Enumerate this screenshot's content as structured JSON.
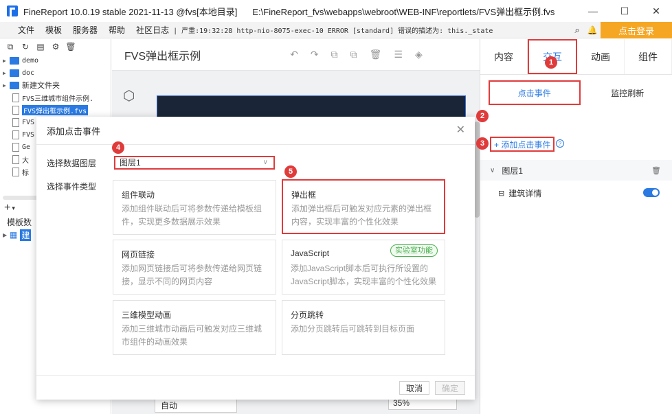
{
  "titlebar": {
    "app_title": "FineReport 10.0.19 stable 2021-11-13 @fvs[本地目录]",
    "path": "E:\\FineReport_fvs\\webapps\\webroot\\WEB-INF\\reportlets/FVS弹出框示例.fvs",
    "minimize": "—",
    "maximize": "☐",
    "close": "✕"
  },
  "menubar": {
    "items": [
      "文件",
      "模板",
      "服务器",
      "帮助",
      "社区日志"
    ],
    "log": "| 严重:19:32:28 http-nio-8075-exec-10 ERROR [standard] 错误的描述为: this._state",
    "login": "点击登录"
  },
  "left": {
    "tree": [
      {
        "label": "demo",
        "type": "folder"
      },
      {
        "label": "doc",
        "type": "folder"
      },
      {
        "label": "新建文件夹",
        "type": "folder"
      },
      {
        "label": "FVS三维城市组件示例.",
        "type": "file"
      },
      {
        "label": "FVS弹出框示例.fvs",
        "type": "file",
        "selected": true
      },
      {
        "label": "FVS",
        "type": "file"
      },
      {
        "label": "FVS",
        "type": "file"
      },
      {
        "label": "Ge",
        "type": "file"
      },
      {
        "label": "大",
        "type": "file"
      },
      {
        "label": "标",
        "type": "file"
      }
    ],
    "lower_label": "模板数",
    "lower_item": "建"
  },
  "center": {
    "doc_title": "FVS弹出框示例",
    "zoom_mode": "自动",
    "zoom_pct": "35%"
  },
  "right": {
    "tabs": [
      "内容",
      "交互",
      "动画",
      "组件"
    ],
    "active_tab": "交互",
    "subtabs": [
      "点击事件",
      "监控刷新"
    ],
    "add_event": "+ 添加点击事件",
    "help": "?",
    "layer": "图层1",
    "event": "建筑详情"
  },
  "dialog": {
    "title": "添加点击事件",
    "close": "✕",
    "label_layer": "选择数据图层",
    "label_type": "选择事件类型",
    "layer_value": "图层1",
    "cards": [
      {
        "title": "组件联动",
        "desc": "添加组件联动后可将参数传递给模板组件，实现更多数据展示效果"
      },
      {
        "title": "弹出框",
        "desc": "添加弹出框后可触发对应元素的弹出框内容，实现丰富的个性化效果"
      },
      {
        "title": "网页链接",
        "desc": "添加网页链接后可将参数传递给网页链接，显示不同的网页内容"
      },
      {
        "title": "JavaScript",
        "desc": "添加JavaScript脚本后可执行所设置的JavaScript脚本，实现丰富的个性化效果",
        "tag": "实验室功能"
      },
      {
        "title": "三维模型动画",
        "desc": "添加三维城市动画后可触发对应三维城市组件的动画效果"
      },
      {
        "title": "分页跳转",
        "desc": "添加分页跳转后可跳转到目标页面"
      }
    ],
    "cancel": "取消",
    "confirm": "确定"
  },
  "badges": [
    "1",
    "2",
    "3",
    "4",
    "5"
  ],
  "colors": {
    "accent": "#2a7ae2",
    "highlight": "#e03b3b",
    "login": "#f5a623"
  }
}
